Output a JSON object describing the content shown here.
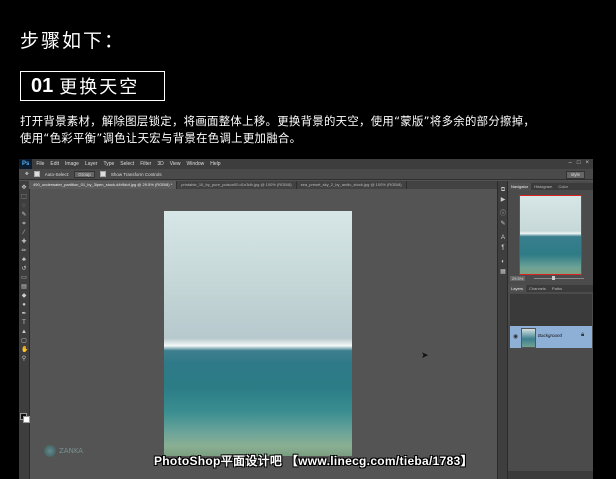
{
  "heading": "步骤如下：",
  "step": {
    "number": "01",
    "title": "更换天空"
  },
  "description": [
    "打开背景素材，解除图层锁定，将画面整体上移。更换背景的天空，使用“蒙版”将多余的部分擦掉，",
    "使用“色彩平衡”调色让天宏与背景在色调上更加融合。"
  ],
  "photoshop": {
    "logo": "Ps",
    "menu": [
      "File",
      "Edit",
      "Image",
      "Layer",
      "Type",
      "Select",
      "Filter",
      "3D",
      "View",
      "Window",
      "Help"
    ],
    "options": {
      "auto_select": "Auto-Select:",
      "group": "Group",
      "transform": "Show Transform Controls",
      "workspace": "style"
    },
    "tabs": [
      "490_underwater_partition_01_by_3ipen_stock.d4r9dof.jpg @ 29.5% (RGB/8) *",
      "printable_10_by_pure_poison00.d1n3dh.jpg @ 100% (RGB/8)",
      "sea_preset_sky_2_by_arctic_stock.jpg @ 100% (RGB/8)"
    ],
    "navigator": {
      "tabs": [
        "Navigator",
        "Histogram",
        "Color"
      ],
      "zoom": "29.5%"
    },
    "layers": {
      "tabs": [
        "Layers",
        "Channels",
        "Paths"
      ],
      "layer_name": "Background"
    }
  },
  "brand_logo": "ZANKA",
  "watermark": "PhotoShop平面设计吧 【www.linecg.com/tieba/1783】",
  "colors": {
    "background": "#000000",
    "ps_ui": "#535353",
    "layer_selected": "#8fb0d6",
    "nav_frame": "#dd2222"
  }
}
